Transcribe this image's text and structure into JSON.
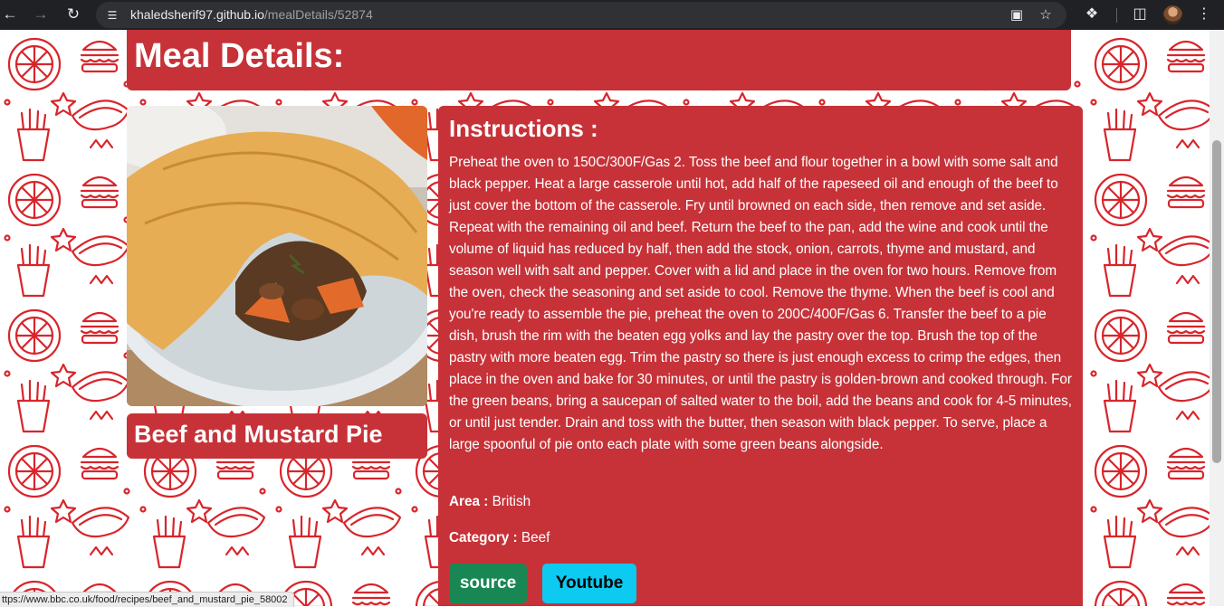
{
  "browser": {
    "url_host": "khaledsherif97.github.io",
    "url_path": "/mealDetails/52874",
    "status_url": "ttps://www.bbc.co.uk/food/recipes/beef_and_mustard_pie_58002"
  },
  "page": {
    "title": "Meal Details:",
    "meal_name": "Beef and Mustard Pie",
    "instructions_heading": "Instructions :",
    "instructions": "Preheat the oven to 150C/300F/Gas 2. Toss the beef and flour together in a bowl with some salt and black pepper. Heat a large casserole until hot, add half of the rapeseed oil and enough of the beef to just cover the bottom of the casserole. Fry until browned on each side, then remove and set aside. Repeat with the remaining oil and beef. Return the beef to the pan, add the wine and cook until the volume of liquid has reduced by half, then add the stock, onion, carrots, thyme and mustard, and season well with salt and pepper. Cover with a lid and place in the oven for two hours. Remove from the oven, check the seasoning and set aside to cool. Remove the thyme. When the beef is cool and you're ready to assemble the pie, preheat the oven to 200C/400F/Gas 6. Transfer the beef to a pie dish, brush the rim with the beaten egg yolks and lay the pastry over the top. Brush the top of the pastry with more beaten egg. Trim the pastry so there is just enough excess to crimp the edges, then place in the oven and bake for 30 minutes, or until the pastry is golden-brown and cooked through. For the green beans, bring a saucepan of salted water to the boil, add the beans and cook for 4-5 minutes, or until just tender. Drain and toss with the butter, then season with black pepper. To serve, place a large spoonful of pie onto each plate with some green beans alongside.",
    "area_label": "Area :",
    "area_value": "British",
    "category_label": "Category :",
    "category_value": "Beef",
    "source_button": "source",
    "youtube_button": "Youtube"
  },
  "colors": {
    "panel": "#c63238",
    "pattern": "#d8252b",
    "source_button": "#198754",
    "youtube_button": "#0dcaf0"
  }
}
